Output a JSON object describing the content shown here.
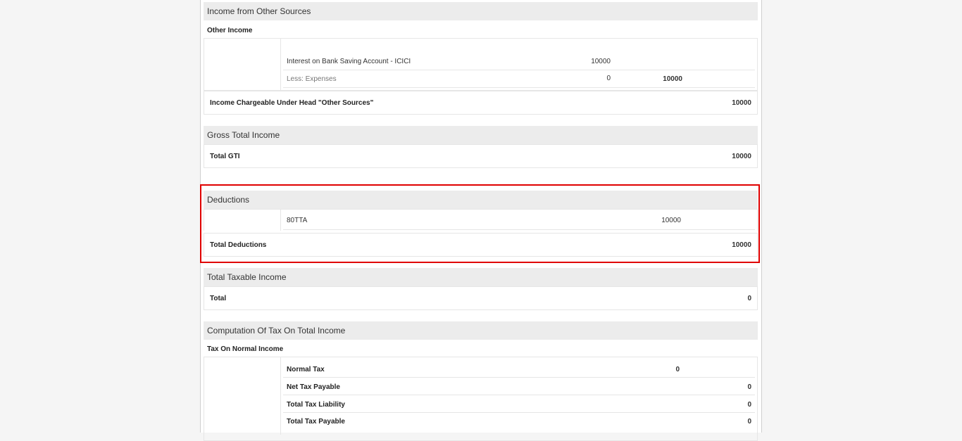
{
  "other_sources": {
    "title": "Income from Other Sources",
    "subhead": "Other Income",
    "rows": [
      {
        "label": "Interest on Bank Saving Account - ICICI",
        "amount": "10000"
      },
      {
        "label": "Less: Expenses",
        "amount": "0",
        "net": "10000"
      }
    ],
    "chargeable_label": "Income Chargeable Under Head \"Other Sources\"",
    "chargeable_value": "10000"
  },
  "gross_total": {
    "title": "Gross Total Income",
    "label": "Total GTI",
    "value": "10000"
  },
  "deductions": {
    "title": "Deductions",
    "item_label": "80TTA",
    "item_value": "10000",
    "total_label": "Total Deductions",
    "total_value": "10000"
  },
  "taxable": {
    "title": "Total Taxable Income",
    "label": "Total",
    "value": "0"
  },
  "computation": {
    "title": "Computation Of Tax On Total Income",
    "subhead": "Tax On Normal Income",
    "normal_tax_label": "Normal Tax",
    "normal_tax_value": "0",
    "net_payable_label": "Net Tax Payable",
    "net_payable_value": "0",
    "liability_label": "Total Tax Liability",
    "liability_value": "0",
    "cut_label": "Total Tax Payable",
    "cut_value": "0"
  },
  "colors": {
    "highlight": "#e00000",
    "section_header_bg": "#ececec"
  }
}
